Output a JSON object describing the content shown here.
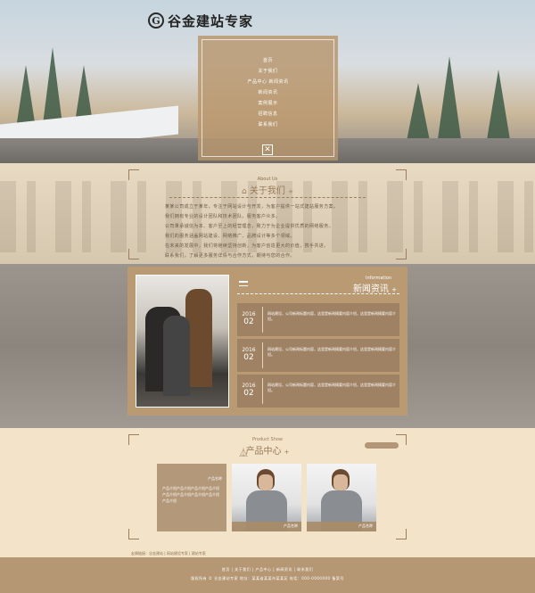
{
  "brand": {
    "logo_letter": "G",
    "logo_text": "谷金建站专家"
  },
  "nav": {
    "items": [
      "首页",
      "关于我们",
      "产品中心 新闻资讯",
      "新闻资讯",
      "案例展示",
      "招聘信息",
      "联系我们"
    ],
    "close_symbol": "✕"
  },
  "about": {
    "title_en": "About Us",
    "title_cn": "关于我们",
    "lines": [
      "某某公司成立于某年，专注于网站设计与开发，为客户提供一站式建站服务方案。",
      "我们拥有专业的设计团队和技术团队，服务客户众多。",
      "公司秉承诚信为本、客户至上的经营理念，致力于为企业提供优质的网络服务。",
      "我们的服务涵盖网站建设、网络推广、品牌设计等多个领域。",
      "在未来的发展中，我们将继续坚持创新，为客户创造更大的价值，携手共进。",
      "联系我们，了解更多服务详情与合作方式，期待与您的合作。"
    ]
  },
  "news": {
    "title_en": "Information",
    "title_cn": "新闻资讯",
    "items": [
      {
        "year": "2016",
        "day": "02",
        "text": "网站建设，公司新闻标题内容，这里是新闻摘要内容介绍，这里是新闻摘要内容介绍。"
      },
      {
        "year": "2016",
        "day": "02",
        "text": "网站建设，公司新闻标题内容，这里是新闻摘要内容介绍，这里是新闻摘要内容介绍。"
      },
      {
        "year": "2016",
        "day": "02",
        "text": "网站建设，公司新闻标题内容，这里是新闻摘要内容介绍，这里是新闻摘要内容介绍。"
      }
    ]
  },
  "products": {
    "title_en": "Product Show",
    "title_cn": "产品中心",
    "cards": [
      {
        "label": "产品名称",
        "text": "产品介绍产品介绍产品介绍产品介绍产品介绍产品介绍产品介绍产品介绍产品介绍"
      },
      {
        "label": "产品名称"
      },
      {
        "label": "产品名称"
      }
    ],
    "footer_text": "友情链接：谷金建站 | 网站建设专家 | 建站专家"
  },
  "footer": {
    "line1": "首页 | 关于我们 | 产品中心 | 新闻资讯 | 联系我们",
    "line2": "版权所有 © 谷金建站专家 地址：某某省某某市某某区 电话：000-0000000 备案号"
  },
  "colors": {
    "accent": "#b59773",
    "panel": "#b99a73",
    "cream": "#f3e3c9"
  }
}
